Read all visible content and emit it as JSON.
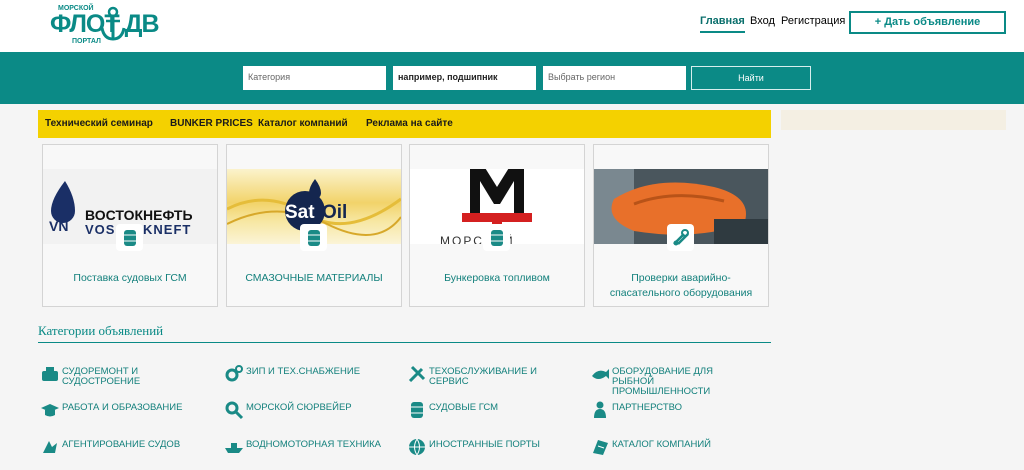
{
  "header": {
    "logo": {
      "main": "ФЛОТ ДВ",
      "top": "МОРСКОЙ",
      "bottom": "ПОРТАЛ"
    },
    "nav": [
      "Главная",
      "Вход",
      "Регистрация"
    ],
    "post_button": "+ Дать объявление"
  },
  "search": {
    "category_placeholder": "Категория",
    "query_value": "например, подшипник",
    "region_placeholder": "Выбрать регион",
    "submit": "Найти"
  },
  "promo_links": [
    "Технический семинар",
    "BUNKER PRICES",
    "Каталог компаний",
    "Реклама на сайте"
  ],
  "cards": [
    {
      "brand": "ВОСТОКНЕФТЬ",
      "brand2": "VOSTOKNEFT",
      "title": "Поставка судовых ГСМ",
      "badge_icon": "barrel-icon"
    },
    {
      "brand": "SatOil",
      "title": "СМАЗОЧНЫЕ МАТЕРИАЛЫ",
      "badge_icon": "barrel-icon"
    },
    {
      "brand": "МОРСКОЙ",
      "title": "Бункеровка топливом",
      "badge_icon": "barrel-icon"
    },
    {
      "title": "Проверки аварийно-спасательного оборудования",
      "badge_icon": "wrench-icon"
    }
  ],
  "categories_title": "Категории объявлений",
  "categories": [
    {
      "label": "Судоремонт и судостроение",
      "icon": "ship-repair-icon"
    },
    {
      "label": "ЗИП и тех.снабжение",
      "icon": "gears-icon"
    },
    {
      "label": "Техобслуживание и сервис",
      "icon": "tools-icon"
    },
    {
      "label": "Оборудование для рыбной промышленности",
      "icon": "fish-icon"
    },
    {
      "label": "Работа и образование",
      "icon": "graduation-icon"
    },
    {
      "label": "Морской сюрвейер",
      "icon": "magnifier-icon"
    },
    {
      "label": "Судовые ГСМ",
      "icon": "barrel-icon"
    },
    {
      "label": "Партнерство",
      "icon": "partner-icon"
    },
    {
      "label": "Агентирование судов",
      "icon": "agency-icon"
    },
    {
      "label": "Водномоторная техника",
      "icon": "boat-icon"
    },
    {
      "label": "Иностранные порты",
      "icon": "globe-icon"
    },
    {
      "label": "Каталог компаний",
      "icon": "catalog-icon"
    }
  ],
  "colors": {
    "teal": "#0b8a86",
    "yellow": "#f4d100",
    "sidebar": "#f4efe3"
  }
}
